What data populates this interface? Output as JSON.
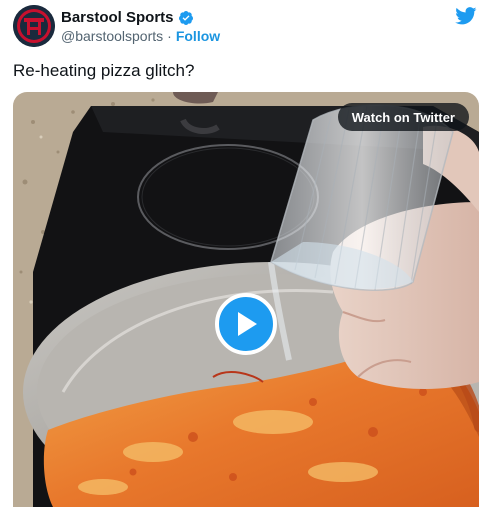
{
  "author": {
    "display_name": "Barstool Sports",
    "handle": "@barstoolsports",
    "separator": "·",
    "follow_label": "Follow",
    "verified": true,
    "avatar_icon": "barstool-logo-icon"
  },
  "tweet": {
    "text": "Re-heating pizza glitch?"
  },
  "media": {
    "watch_label": "Watch on Twitter",
    "play_icon": "play-icon"
  },
  "colors": {
    "accent": "#1d9bf0",
    "follow": "#1b95e0",
    "text": "#0f1419",
    "muted": "#536471"
  }
}
